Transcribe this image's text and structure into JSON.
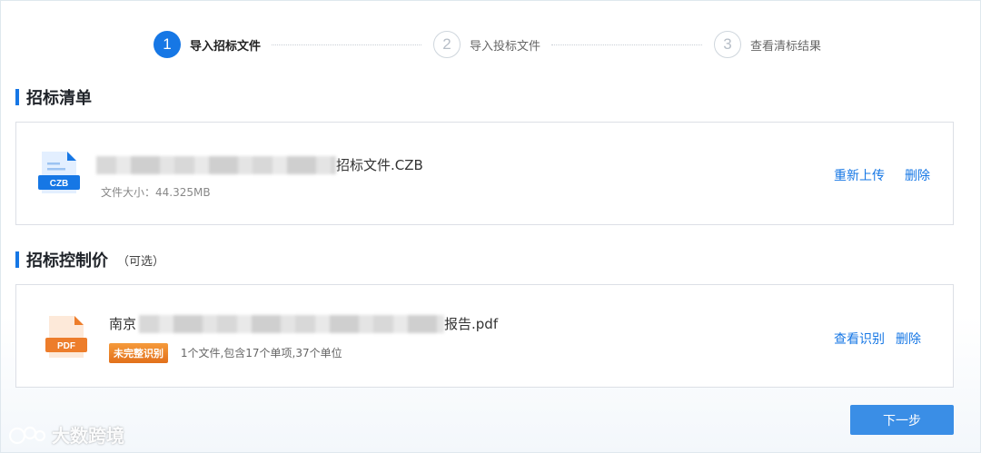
{
  "steps": [
    {
      "number": "1",
      "label": "导入招标文件"
    },
    {
      "number": "2",
      "label": "导入投标文件"
    },
    {
      "number": "3",
      "label": "查看清标结果"
    }
  ],
  "sections": {
    "tender_list": {
      "title": "招标清单",
      "file": {
        "icon_label": "CZB",
        "name_suffix": "招标文件.CZB",
        "size_text": "文件大小：44.325MB",
        "actions": {
          "reupload": "重新上传",
          "delete": "删除"
        }
      }
    },
    "control_price": {
      "title": "招标控制价",
      "hint": "（可选）",
      "file": {
        "icon_label": "PDF",
        "name_prefix": "南京",
        "name_suffix": "报告.pdf",
        "badge": "未完整识别",
        "summary": "1个文件,包含17个单项,37个单位",
        "actions": {
          "view": "查看识别",
          "delete": "删除"
        }
      }
    }
  },
  "next_button": "下一步",
  "watermark": "大数跨境",
  "colors": {
    "accent": "#1677e5",
    "warning": "#e97a22"
  }
}
